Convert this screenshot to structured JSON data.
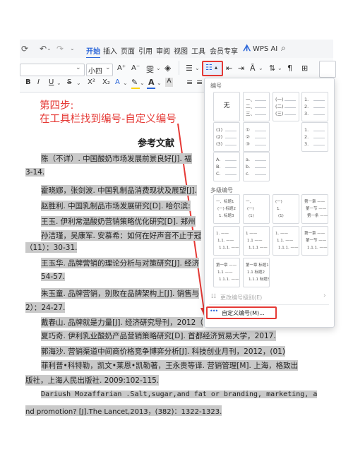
{
  "toolbar": {
    "tabs": [
      "开始",
      "插入",
      "页面",
      "引用",
      "审阅",
      "视图",
      "工具",
      "会员专享"
    ],
    "wps_ai_label": "WPS AI",
    "font_size": "小四",
    "font_style_glyphs": [
      "B",
      "I",
      "U",
      "S",
      "X²",
      "X₂",
      "A"
    ],
    "grow_font": "A⁺",
    "shrink_font": "A⁻"
  },
  "annotation": {
    "step": "第四步:",
    "instruction": "在工具栏找到编号-自定义编号"
  },
  "document": {
    "heading": "参考文献",
    "lines": [
      {
        "text": "陈（不详）. 中国酸奶市场发展前景良好[J]. 福",
        "hl": true
      },
      {
        "text": "3-14.",
        "hl": true
      },
      {
        "text": "霍晓娜，张剑波. 中国乳制品消费现状及展望[J].",
        "hl": true
      },
      {
        "text": "赵胜利. 中国乳制品市场发展研究[D]. 哈尔滨:",
        "hl": true
      },
      {
        "text": "王玉. 伊利常温酸奶营销策略优化研究[D]. 郑州",
        "hl": true
      },
      {
        "text": "孙洁瑾，吴康军. 安慕希：如何在好声音不止于冠",
        "hl": true
      },
      {
        "text": "（11）：30-31.",
        "hl": true
      },
      {
        "text": "王玉华. 品牌营销的理论分析与对策研究[J]. 经济",
        "hl": true
      },
      {
        "text": "54-57.",
        "hl": true
      },
      {
        "text": "朱玉童. 品牌营销，别败在品牌架构上[J]. 销售与",
        "hl": true
      },
      {
        "text": "2）：24-27.",
        "hl": true
      },
      {
        "text": "戴春山. 品牌就是力量[J]. 经济研究导刊，2012（",
        "hl": true
      },
      {
        "text": "夏巧奇. 伊利乳业酸奶产品营销策略研究[D]. 首都经济贸易大学，2017.",
        "hl": true
      },
      {
        "text": "郭海沙. 营销渠道中间商价格竞争博弈分析[J]. 科技创业月刊，2012，(01)",
        "hl": true
      },
      {
        "text": "菲利普•科特勒，凯文•莱恩•凯勒著，王永贵等译. 营销管理[M]. 上海，格致出",
        "hl": true
      },
      {
        "text": "版社，上海人民出版社. 2009:102-115.",
        "hl": true
      },
      {
        "text": "Dariush Mozaffarian .Salt,sugar,and fat or branding, marketing, a",
        "hl": true
      },
      {
        "text": "nd promotion? [J].The Lancet,2013，(382)：1322-1323.",
        "hl": true
      }
    ]
  },
  "numbering_menu": {
    "section_title": "编号",
    "none_label": "无",
    "styles": [
      [
        "一、",
        "二、",
        "三、"
      ],
      [
        "(一)",
        "(二)",
        "(三)"
      ],
      [
        "1.",
        "2.",
        "3."
      ],
      [
        "(1)",
        "(2)",
        "(3)"
      ],
      [
        "①",
        "②",
        "③"
      ],
      [
        "1.",
        "2.",
        "3."
      ],
      [
        "A.",
        "B.",
        "C."
      ],
      [
        "a.",
        "b.",
        "c."
      ]
    ],
    "multilevel_title": "多级编号",
    "multilevel": [
      [
        "一、标题1",
        "(一) 标题2",
        "1. 标题3"
      ],
      [
        "一、",
        "(一)",
        "(1)"
      ],
      [
        "(一)",
        "1.",
        "(1)"
      ],
      [
        "第一章 ——",
        "第一节 ——",
        "第一条 ——"
      ],
      [
        "1. ——",
        "1.1. ——",
        "1.1.1. ——"
      ],
      [
        "1 ——",
        "1.1 ——",
        "1.1.1 ——"
      ],
      [
        "1. ——",
        "1.1. ——",
        "1.1.1. ——"
      ],
      [
        "第一章 ——",
        "第一节 ——",
        "1.1.1. ——"
      ],
      [
        "第一章 ——",
        "1.1 ——",
        "1.1.1. ——"
      ],
      [
        "第一章 标题1",
        "1.1 标题2",
        "1.1.1 标题3"
      ]
    ],
    "change_level": "更改编号级别(E)",
    "custom_numbering": "自定义编号(M)..."
  },
  "colors": {
    "accent": "#2b66d9",
    "annotation": "#e53935",
    "highlight": "#c9c9c9"
  }
}
